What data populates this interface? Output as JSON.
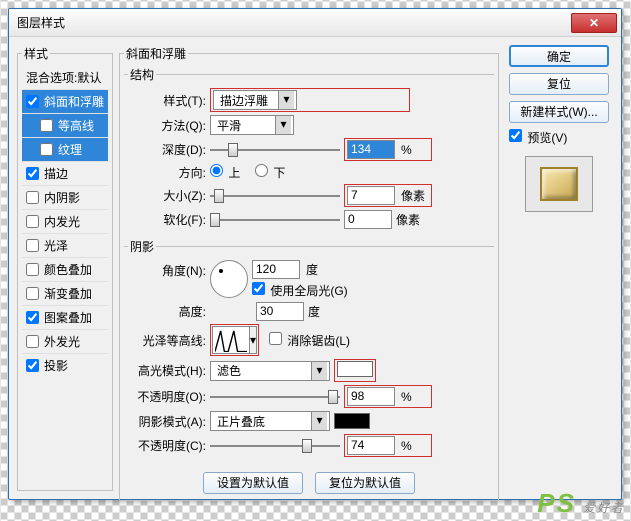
{
  "dialog": {
    "title": "图层样式"
  },
  "left": {
    "legend": "样式",
    "blend_options": "混合选项:默认",
    "items": [
      {
        "label": "斜面和浮雕",
        "checked": true,
        "selected": true,
        "sub": false
      },
      {
        "label": "等高线",
        "checked": false,
        "selected": true,
        "sub": true
      },
      {
        "label": "纹理",
        "checked": false,
        "selected": true,
        "sub": true
      },
      {
        "label": "描边",
        "checked": true,
        "selected": false,
        "sub": false
      },
      {
        "label": "内阴影",
        "checked": false,
        "selected": false,
        "sub": false
      },
      {
        "label": "内发光",
        "checked": false,
        "selected": false,
        "sub": false
      },
      {
        "label": "光泽",
        "checked": false,
        "selected": false,
        "sub": false
      },
      {
        "label": "颜色叠加",
        "checked": false,
        "selected": false,
        "sub": false
      },
      {
        "label": "渐变叠加",
        "checked": false,
        "selected": false,
        "sub": false
      },
      {
        "label": "图案叠加",
        "checked": true,
        "selected": false,
        "sub": false
      },
      {
        "label": "外发光",
        "checked": false,
        "selected": false,
        "sub": false
      },
      {
        "label": "投影",
        "checked": true,
        "selected": false,
        "sub": false
      }
    ]
  },
  "bevel": {
    "legend": "斜面和浮雕",
    "structure": {
      "legend": "结构",
      "style_label": "样式(T):",
      "style_value": "描边浮雕",
      "technique_label": "方法(Q):",
      "technique_value": "平滑",
      "depth_label": "深度(D):",
      "depth_value": "134",
      "depth_unit": "%",
      "direction_label": "方向:",
      "direction_up": "上",
      "direction_down": "下",
      "size_label": "大小(Z):",
      "size_value": "7",
      "size_unit": "像素",
      "soften_label": "软化(F):",
      "soften_value": "0",
      "soften_unit": "像素"
    },
    "shading": {
      "legend": "阴影",
      "angle_label": "角度(N):",
      "angle_value": "120",
      "angle_unit": "度",
      "global_light": "使用全局光(G)",
      "altitude_label": "高度:",
      "altitude_value": "30",
      "altitude_unit": "度",
      "gloss_label": "光泽等高线:",
      "antialias": "消除锯齿(L)",
      "highlight_mode_label": "高光模式(H):",
      "highlight_mode_value": "滤色",
      "highlight_opacity_label": "不透明度(O):",
      "highlight_opacity_value": "98",
      "highlight_opacity_unit": "%",
      "shadow_mode_label": "阴影模式(A):",
      "shadow_mode_value": "正片叠底",
      "shadow_opacity_label": "不透明度(C):",
      "shadow_opacity_value": "74",
      "shadow_opacity_unit": "%"
    },
    "footer": {
      "make_default": "设置为默认值",
      "reset_default": "复位为默认值"
    }
  },
  "right": {
    "ok": "确定",
    "cancel": "复位",
    "new_style": "新建样式(W)...",
    "preview": "预览(V)"
  },
  "watermark": {
    "ps": "PS",
    "txt": "爱好者"
  }
}
